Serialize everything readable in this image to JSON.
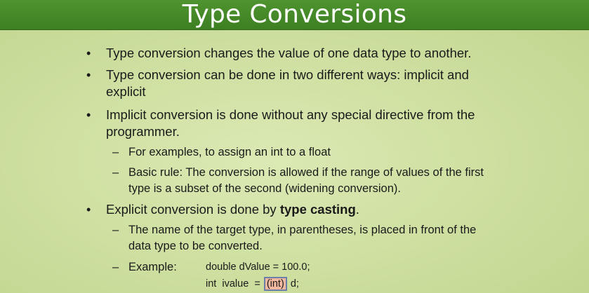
{
  "slide": {
    "title": "Type Conversions",
    "bullets": [
      {
        "lines": [
          "Type conversion changes the value of one data type to another."
        ]
      },
      {
        "lines": [
          "Type conversion can be done in two different ways: implicit and",
          "explicit"
        ]
      },
      {
        "lines": [
          "Implicit conversion is done without any special directive from the",
          "programmer."
        ]
      },
      {
        "lines_prefix": "Explicit conversion is done by ",
        "bold": "type casting",
        "suffix": "."
      }
    ],
    "implicit_sub": [
      {
        "lines": [
          "For examples, to assign an int to a float"
        ]
      },
      {
        "lines": [
          "Basic rule: The conversion is allowed if the range of values of the first",
          "type is a subset of the second (widening conversion)."
        ]
      }
    ],
    "explicit_sub": [
      {
        "lines": [
          "The name of the target type, in parentheses, is placed in front of the",
          "data type to be converted."
        ]
      },
      {
        "label": "Example:"
      }
    ],
    "code": {
      "line1": "double dValue = 100.0;",
      "line2_prefix": "int  ivalue  = ",
      "line2_cast": "(int)",
      "line2_suffix": " d;"
    },
    "bullet_symbol": "•",
    "dash_symbol": "–"
  },
  "colors": {
    "title_bar": "#3d7f22",
    "background": "#cfe0a2",
    "cast_highlight": "#f2b8a0"
  }
}
